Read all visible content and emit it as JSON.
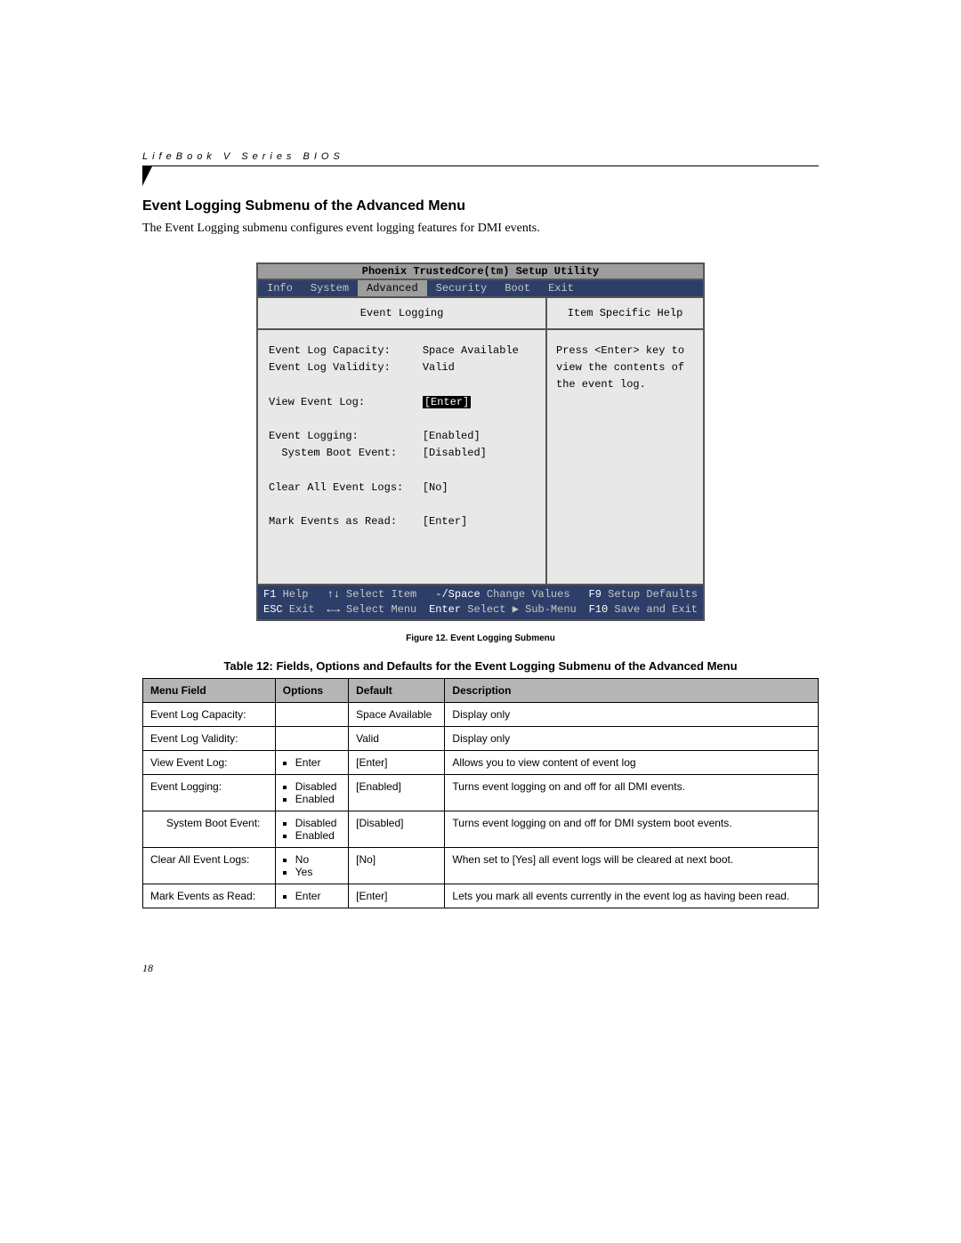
{
  "header": "LifeBook V Series BIOS",
  "section_title": "Event Logging Submenu of the Advanced Menu",
  "section_intro": "The Event Logging submenu configures event logging features for DMI events.",
  "bios": {
    "title": "Phoenix TrustedCore(tm) Setup Utility",
    "tabs": [
      "Info",
      "System",
      "Advanced",
      "Security",
      "Boot",
      "Exit"
    ],
    "active_tab": "Advanced",
    "main_title": "Event Logging",
    "help_title": "Item Specific Help",
    "rows": [
      {
        "label": "Event Log Capacity:",
        "value": "Space Available"
      },
      {
        "label": "Event Log Validity:",
        "value": "Valid"
      },
      {
        "blank": true
      },
      {
        "label": "View Event Log:",
        "value": "[Enter]",
        "highlight": true
      },
      {
        "blank": true
      },
      {
        "label": "Event Logging:",
        "value": "[Enabled]"
      },
      {
        "label": "  System Boot Event:",
        "value": "[Disabled]"
      },
      {
        "blank": true
      },
      {
        "label": "Clear All Event Logs:",
        "value": "[No]"
      },
      {
        "blank": true
      },
      {
        "label": "Mark Events as Read:",
        "value": "[Enter]"
      }
    ],
    "help_text": "Press <Enter> key to view the contents of the event log.",
    "footer": {
      "l1a": {
        "k": "F1",
        "t": "Help"
      },
      "l1b": {
        "k": "↑↓",
        "t": "Select Item"
      },
      "l1c": {
        "k": "-/Space",
        "t": "Change Values"
      },
      "l1d": {
        "k": "F9",
        "t": "Setup Defaults"
      },
      "l2a": {
        "k": "ESC",
        "t": "Exit"
      },
      "l2b": {
        "k": "←→",
        "t": "Select Menu"
      },
      "l2c": {
        "k": "Enter",
        "t": "Select ▶ Sub-Menu"
      },
      "l2d": {
        "k": "F10",
        "t": "Save and Exit"
      }
    }
  },
  "figure_caption": "Figure 12.   Event Logging Submenu",
  "table_caption": "Table 12: Fields, Options and Defaults for the Event Logging Submenu of the Advanced Menu",
  "table": {
    "headers": [
      "Menu Field",
      "Options",
      "Default",
      "Description"
    ],
    "rows": [
      {
        "field": "Event Log Capacity:",
        "indent": false,
        "options": [],
        "default": "Space Available",
        "desc": "Display only"
      },
      {
        "field": "Event Log Validity:",
        "indent": false,
        "options": [],
        "default": "Valid",
        "desc": "Display only"
      },
      {
        "field": "View Event Log:",
        "indent": false,
        "options": [
          "Enter"
        ],
        "default": "[Enter]",
        "desc": "Allows you to view content of event log"
      },
      {
        "field": "Event Logging:",
        "indent": false,
        "options": [
          "Disabled",
          "Enabled"
        ],
        "default": "[Enabled]",
        "desc": "Turns event logging on and off for all DMI events."
      },
      {
        "field": "System Boot Event:",
        "indent": true,
        "options": [
          "Disabled",
          "Enabled"
        ],
        "default": "[Disabled]",
        "desc": "Turns event logging on and off for DMI system boot events."
      },
      {
        "field": "Clear All Event Logs:",
        "indent": false,
        "options": [
          "No",
          "Yes"
        ],
        "default": "[No]",
        "desc": "When set to [Yes] all event logs will be cleared at next boot."
      },
      {
        "field": "Mark Events as Read:",
        "indent": false,
        "options": [
          "Enter"
        ],
        "default": "[Enter]",
        "desc": "Lets you mark all events currently in the event log as having been read."
      }
    ]
  },
  "page_number": "18"
}
